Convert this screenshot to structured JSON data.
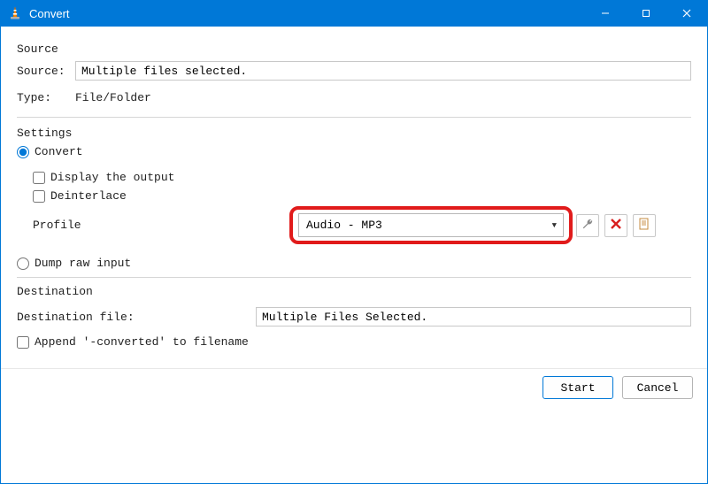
{
  "window": {
    "title": "Convert"
  },
  "source": {
    "section_label": "Source",
    "source_label": "Source:",
    "source_value": "Multiple files selected.",
    "type_label": "Type:",
    "type_value": "File/Folder"
  },
  "settings": {
    "section_label": "Settings",
    "convert_label": "Convert",
    "display_output_label": "Display the output",
    "deinterlace_label": "Deinterlace",
    "profile_label": "Profile",
    "profile_value": "Audio - MP3",
    "dump_raw_label": "Dump raw input"
  },
  "destination": {
    "section_label": "Destination",
    "file_label": "Destination file:",
    "file_value": "Multiple Files Selected.",
    "append_label": "Append '-converted' to filename"
  },
  "buttons": {
    "start": "Start",
    "cancel": "Cancel"
  },
  "icons": {
    "wrench": "edit-profile",
    "delete": "delete-profile",
    "new": "new-profile"
  }
}
